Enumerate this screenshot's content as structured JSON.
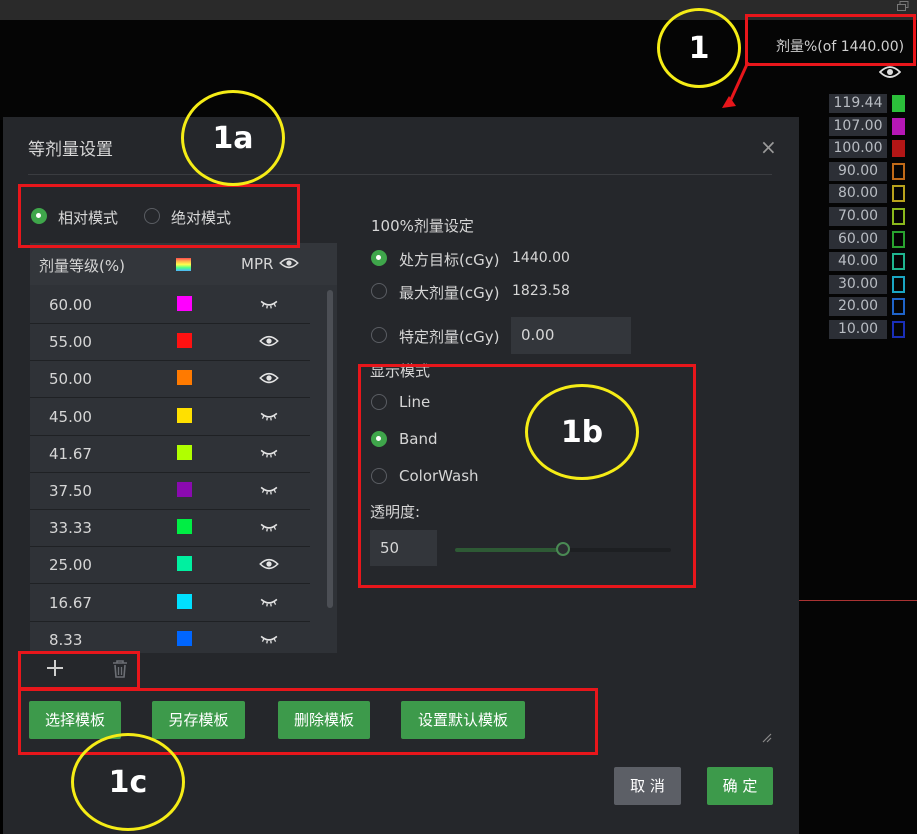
{
  "legend": {
    "title": "剂量%(of 1440.00)",
    "rows": [
      {
        "value": "119.44",
        "color": "#2bbf3a",
        "filled": true
      },
      {
        "value": "107.00",
        "color": "#b517b5",
        "filled": true
      },
      {
        "value": "100.00",
        "color": "#b31616",
        "filled": true
      },
      {
        "value": "90.00",
        "color": "#c06a18",
        "filled": false
      },
      {
        "value": "80.00",
        "color": "#b8a21c",
        "filled": false
      },
      {
        "value": "70.00",
        "color": "#8ab81c",
        "filled": false
      },
      {
        "value": "60.00",
        "color": "#29a32f",
        "filled": false
      },
      {
        "value": "40.00",
        "color": "#1fb58f",
        "filled": false
      },
      {
        "value": "30.00",
        "color": "#1aa6c4",
        "filled": false
      },
      {
        "value": "20.00",
        "color": "#1f64c9",
        "filled": false
      },
      {
        "value": "10.00",
        "color": "#1a2fb8",
        "filled": false
      }
    ]
  },
  "dialog": {
    "title": "等剂量设置",
    "close_symbol": "×",
    "mode": {
      "relative": "相对模式",
      "absolute": "绝对模式",
      "selected": "relative"
    },
    "table": {
      "headers": {
        "level": "剂量等级(%)",
        "mpr": "MPR"
      },
      "rows": [
        {
          "value": "60.00",
          "color": "#ff00ff",
          "visible": false
        },
        {
          "value": "55.00",
          "color": "#ff1111",
          "visible": true
        },
        {
          "value": "50.00",
          "color": "#ff7a00",
          "visible": true
        },
        {
          "value": "45.00",
          "color": "#ffe000",
          "visible": false
        },
        {
          "value": "41.67",
          "color": "#b0ff00",
          "visible": false
        },
        {
          "value": "37.50",
          "color": "#8a0ab0",
          "visible": false
        },
        {
          "value": "33.33",
          "color": "#00ee44",
          "visible": false
        },
        {
          "value": "25.00",
          "color": "#00f0a0",
          "visible": true
        },
        {
          "value": "16.67",
          "color": "#00e0ff",
          "visible": false
        },
        {
          "value": "8.33",
          "color": "#0066ff",
          "visible": false
        }
      ]
    },
    "prescription": {
      "section_title": "100%剂量设定",
      "options": [
        {
          "label": "处方目标(cGy)",
          "value": "1440.00",
          "selected": true
        },
        {
          "label": "最大剂量(cGy)",
          "value": "1823.58",
          "selected": false
        },
        {
          "label": "特定剂量(cGy)",
          "value": "0.00",
          "selected": false
        }
      ]
    },
    "display": {
      "title": "显示模式",
      "options": [
        {
          "label": "Line",
          "selected": false
        },
        {
          "label": "Band",
          "selected": true
        },
        {
          "label": "ColorWash",
          "selected": false
        }
      ],
      "opacity_label": "透明度:",
      "opacity_value": "50",
      "opacity_fraction": 0.5
    },
    "template_buttons": [
      "选择模板",
      "另存模板",
      "删除模板",
      "设置默认模板"
    ],
    "cancel": "取 消",
    "ok": "确 定"
  },
  "annotations": [
    "1",
    "1a",
    "1b",
    "1c"
  ],
  "colors": {
    "accent": "#3d9a4b",
    "highlight_box": "#e8161b",
    "circle": "#f5ec16"
  }
}
